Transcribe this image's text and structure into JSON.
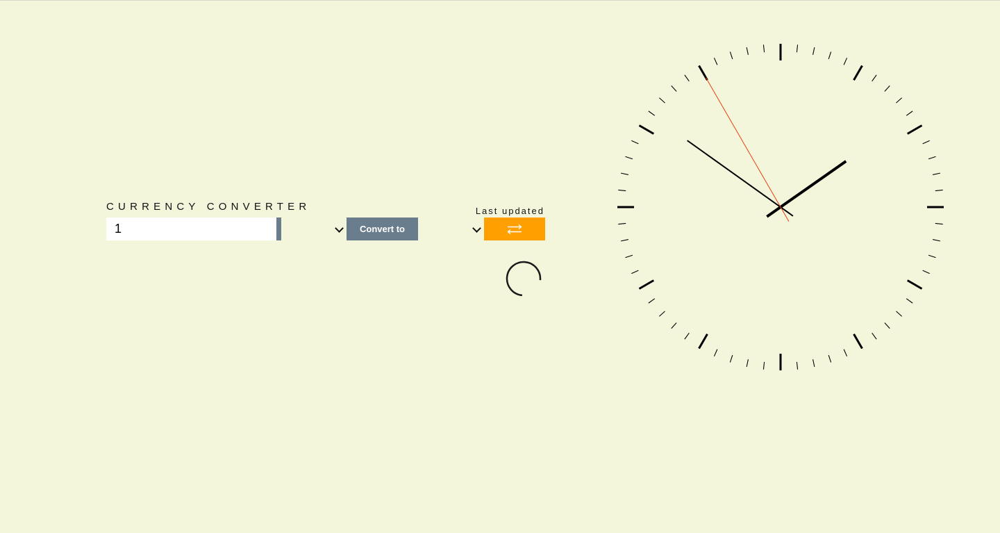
{
  "converter": {
    "title": "CURRENCY CONVERTER",
    "last_updated_label": "Last updated",
    "amount_value": "1",
    "from_currency": "",
    "to_currency": "",
    "convert_label": "Convert to",
    "swap_icon": "swap-arrows-icon",
    "accent_color": "#ff9f00",
    "slate_color": "#6a7d8c"
  },
  "loading": {
    "spinner_icon": "loading-spinner-icon"
  },
  "clock": {
    "time": {
      "hours": 1,
      "minutes": 50,
      "seconds": 55
    },
    "second_hand_color": "#e8410d"
  }
}
